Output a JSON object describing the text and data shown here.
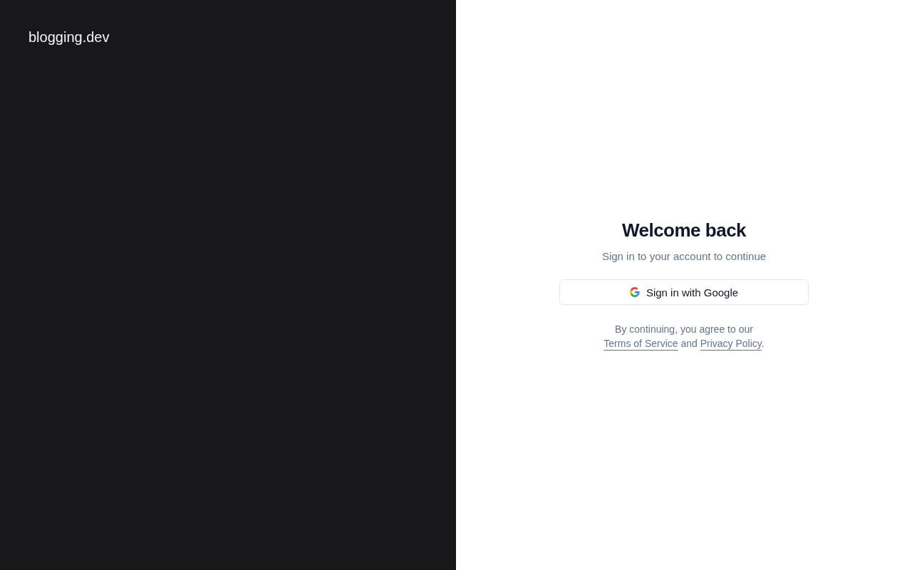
{
  "brand": {
    "name": "blogging.dev"
  },
  "login": {
    "title": "Welcome back",
    "subtitle": "Sign in to your account to continue",
    "google_button": {
      "label": "Sign in with Google"
    },
    "legal": {
      "before": "By continuing, you agree to our",
      "links": [
        "Terms of Service",
        "Privacy Policy"
      ],
      "between": "and",
      "after": "."
    }
  }
}
